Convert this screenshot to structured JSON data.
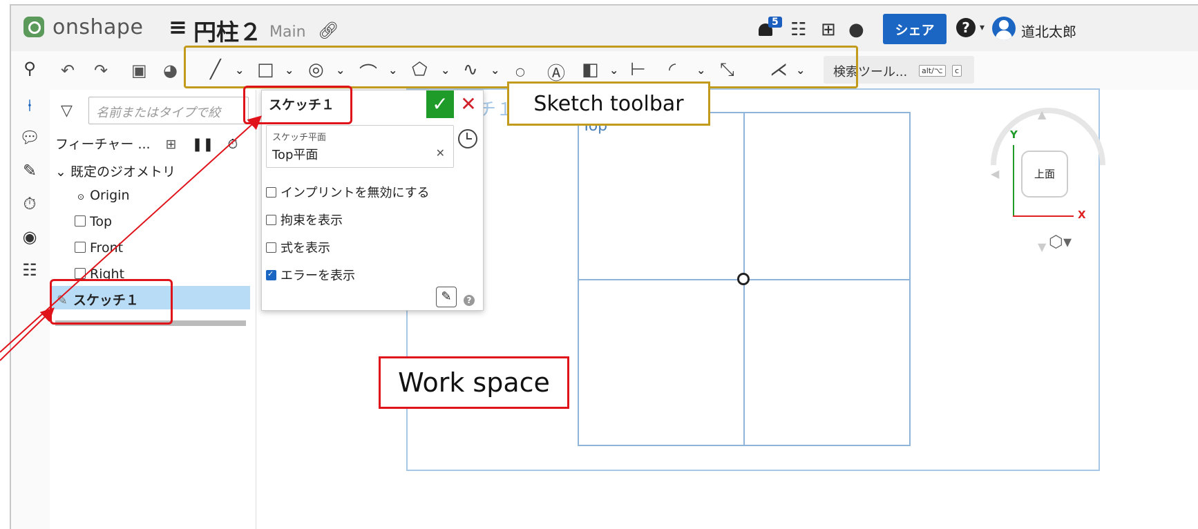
{
  "app": {
    "brand": "onshape",
    "doc_title": "円柱２",
    "workspace": "Main",
    "notification_count": "5",
    "share_label": "シェア",
    "help_label": "?",
    "user_name": "道北太郎"
  },
  "toolbar": {
    "search_tools_label": "検索ツール...",
    "shortcut_keys": [
      "alt/⌥",
      "c"
    ]
  },
  "tree": {
    "filter_placeholder": "名前またはタイプで絞",
    "header_label": "フィーチャー ...",
    "default_geometry": "既定のジオメトリ",
    "items": [
      "Origin",
      "Top",
      "Front",
      "Right"
    ],
    "sketch_item": "スケッチ１"
  },
  "sketch_dialog": {
    "title": "スケッチ１",
    "plane_label": "スケッチ平面",
    "plane_value": "Top平面",
    "options": [
      {
        "label": "インプリントを無効にする",
        "checked": false
      },
      {
        "label": "拘束を表示",
        "checked": false
      },
      {
        "label": "式を表示",
        "checked": false
      },
      {
        "label": "エラーを表示",
        "checked": true
      }
    ]
  },
  "canvas": {
    "plane_label": "Top",
    "sketch_watermark": "チ１",
    "view_cube_face": "上面",
    "axis_x": "X",
    "axis_y": "Y"
  },
  "annotations": {
    "sketch_toolbar": "Sketch toolbar",
    "work_space": "Work space"
  },
  "colors": {
    "accent": "#1a66c2",
    "confirm": "#1f9b2a",
    "cancel": "#d0202a",
    "annotation_yellow": "#c29b1c",
    "annotation_red": "#e0131b"
  }
}
